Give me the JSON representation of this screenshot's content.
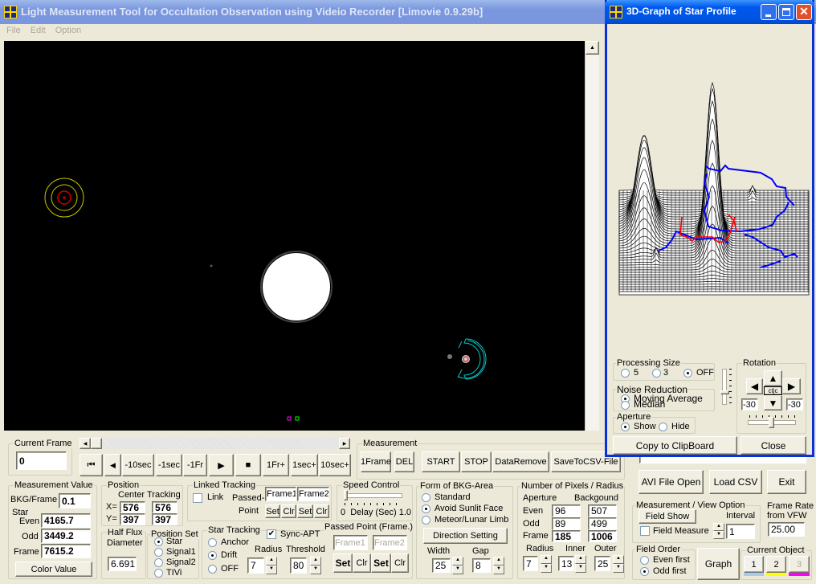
{
  "main_window": {
    "title": "Light Measurement Tool for Occultation Observation using Videio Recorder [Limovie 0.9.29b]",
    "menu": [
      "File",
      "Edit",
      "Option"
    ]
  },
  "graph_window": {
    "title": "3D-Graph of Star Profile",
    "processing_size": {
      "label": "Processing Size",
      "options": [
        "5",
        "3",
        "OFF"
      ],
      "selected": "OFF"
    },
    "noise_reduction": {
      "label": "Noise Reduction",
      "options": [
        "Moving Average",
        "Median"
      ],
      "selected": "Moving Average"
    },
    "aperture": {
      "label": "Aperture",
      "options": [
        "Show",
        "Hide"
      ],
      "selected": "Show"
    },
    "rotation": {
      "label": "Rotation",
      "center": "ctjc",
      "left_value": "-30",
      "right_value": "-30"
    },
    "copy_label": "Copy to ClipBoard",
    "close_label": "Close",
    "colors": {
      "peak_contour": "#ff0000",
      "aperture_contour": "#0000ff"
    }
  },
  "current_frame": {
    "label": "Current Frame",
    "value": "0"
  },
  "playback": [
    "⏮",
    "◀",
    "-10sec",
    "-1sec",
    "-1Fr",
    "▶",
    "■",
    "1Fr+",
    "1sec+",
    "10sec+"
  ],
  "measurement": {
    "label": "Measurement",
    "buttons": [
      "1Frame",
      "DEL",
      "START",
      "STOP",
      "DataRemove",
      "SaveToCSV-File"
    ]
  },
  "measurement_value": {
    "label": "Measurement Value",
    "bkg_label": "BKG/Frame",
    "bkg": "0.1",
    "star_label": "Star",
    "even_label": "Even",
    "even": "4165.7",
    "odd_label": "Odd",
    "odd": "3449.2",
    "frame_label": "Frame",
    "frame": "7615.2",
    "color_button": "Color Value"
  },
  "position": {
    "label": "Position",
    "center_label": "Center",
    "tracking_label": "Tracking",
    "x_label": "X=",
    "y_label": "Y=",
    "center_x": "576",
    "center_y": "397",
    "tracking_x": "576",
    "tracking_y": "397"
  },
  "half_flux": {
    "label1": "Half Flux",
    "label2": "Diameter",
    "value": "6.691"
  },
  "position_set": {
    "label": "Position Set",
    "options": [
      "Star",
      "Signal1",
      "Signal2",
      "TIVi"
    ],
    "selected": "Star"
  },
  "linked_tracking": {
    "label": "Linked Tracking",
    "link_label": "Link",
    "link_checked": false,
    "passed_label": "Passed-",
    "point_label": "Point",
    "frame1": "Frame1",
    "frame2": "Frame2",
    "set": "Set",
    "clr": "Clr"
  },
  "speed_control": {
    "label": "Speed Control",
    "scale_label": "0  Delay (Sec) 1.0",
    "value": 0
  },
  "star_tracking": {
    "label": "Star Tracking",
    "options": [
      "Anchor",
      "Drift",
      "OFF"
    ],
    "selected": "Drift",
    "sync_label": "Sync-APT",
    "sync_checked": true,
    "radius_label": "Radius",
    "radius": "7",
    "threshold_label": "Threshold",
    "threshold": "80"
  },
  "passed_point": {
    "label": "Passed Point (Frame.)",
    "frame1": "Frame1",
    "frame2": "Frame2",
    "set": "Set",
    "clr": "Clr"
  },
  "bkg_area": {
    "label": "Form of BKG-Area",
    "options": [
      "Standard",
      "Avoid Sunlit Face",
      "Meteor/Lunar Limb"
    ],
    "selected": "Avoid Sunlit Face",
    "direction_button": "Direction Setting",
    "width_label": "Width",
    "width": "25",
    "gap_label": "Gap",
    "gap": "8"
  },
  "pixels": {
    "label": "Number of Pixels / Radius",
    "aperture_label": "Aperture",
    "background_label": "Backgound",
    "rows": [
      {
        "label": "Even",
        "aperture": "96",
        "background": "507"
      },
      {
        "label": "Odd",
        "aperture": "89",
        "background": "499"
      },
      {
        "label": "Frame",
        "aperture": "185",
        "background": "1006"
      }
    ],
    "radius_label": "Radius",
    "radius": "7",
    "inner_label": "Inner",
    "inner": "13",
    "outer_label": "Outer",
    "outer": "25"
  },
  "file": {
    "avi_open": "AVI File Open",
    "load_csv": "Load CSV",
    "exit": "Exit"
  },
  "view_option": {
    "label": "Measurement / View Option",
    "field_show": "Field Show",
    "interval_label": "Interval",
    "interval": "1",
    "field_measure_label": "Field Measure",
    "field_measure_checked": false
  },
  "frame_rate": {
    "label1": "Frame Rate",
    "label2": "from VFW",
    "value": "25.00"
  },
  "field_order": {
    "label": "Field Order",
    "options": [
      "Even first",
      "Odd first"
    ],
    "selected": "Odd first"
  },
  "graph_button": "Graph",
  "current_object": {
    "label": "Current Object",
    "buttons": [
      "1",
      "2",
      "3"
    ],
    "selected": "1",
    "colors": [
      "#a6caf0",
      "#ffff00",
      "#ff00ff"
    ]
  }
}
